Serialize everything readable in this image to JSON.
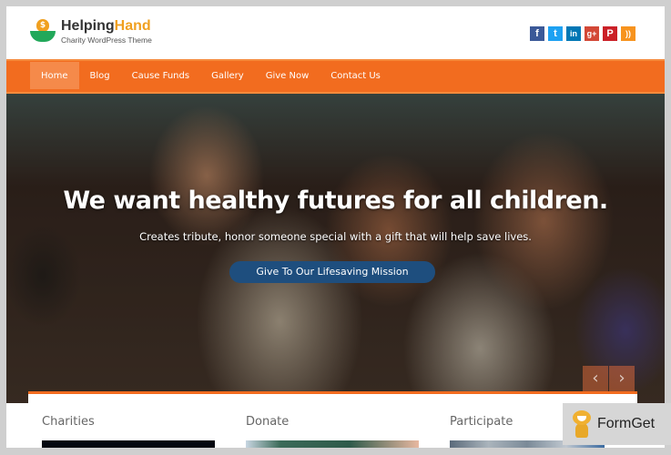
{
  "header": {
    "logo_title_part1": "Helping",
    "logo_title_part2": "Hand",
    "logo_subtitle": "Charity WordPress Theme",
    "logo_icon_symbol": "$",
    "social": [
      {
        "name": "facebook",
        "glyph": "f",
        "color": "#3b5998"
      },
      {
        "name": "twitter",
        "glyph": "t",
        "color": "#1da1f2"
      },
      {
        "name": "linkedin",
        "glyph": "in",
        "color": "#0077b5"
      },
      {
        "name": "google-plus",
        "glyph": "g+",
        "color": "#d34836"
      },
      {
        "name": "pinterest",
        "glyph": "P",
        "color": "#cb2027"
      },
      {
        "name": "rss",
        "glyph": "))",
        "color": "#f7931e"
      }
    ]
  },
  "nav": {
    "items": [
      {
        "label": "Home",
        "active": true
      },
      {
        "label": "Blog"
      },
      {
        "label": "Cause Funds"
      },
      {
        "label": "Gallery"
      },
      {
        "label": "Give Now"
      },
      {
        "label": "Contact Us"
      }
    ],
    "color": "#f26c1f"
  },
  "hero": {
    "title": "We want healthy futures for all children.",
    "subtitle": "Creates tribute, honor someone special with a gift that will help save lives.",
    "button_label": "Give To Our Lifesaving Mission",
    "button_color": "#1e4e7e",
    "prev_glyph": "‹",
    "next_glyph": "›"
  },
  "cards": [
    {
      "title": "Charities"
    },
    {
      "title": "Donate"
    },
    {
      "title": "Participate"
    }
  ],
  "badge": {
    "text": "FormGet"
  }
}
